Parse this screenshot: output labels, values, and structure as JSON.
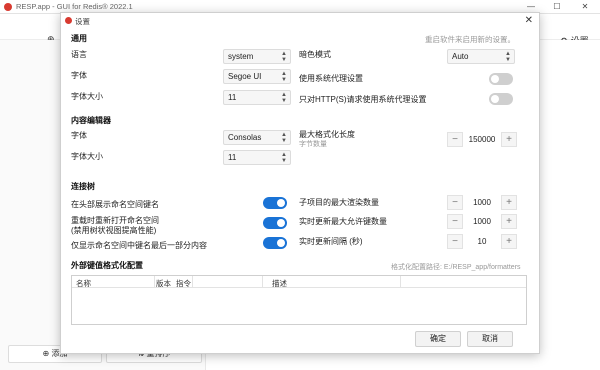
{
  "app": {
    "title": "RESP.app - GUI for Redis® 2022.1",
    "settings_label": "设置",
    "add_connection_label": "添加",
    "sort_label": "重排序",
    "minimize": "—",
    "maximize": "☐",
    "close": "✕",
    "plus_icon": "⊕"
  },
  "dialog": {
    "title": "设置",
    "close": "✕",
    "restart_hint": "重启软件来启用新的设置。",
    "general": {
      "title": "通用",
      "language_label": "语言",
      "language_value": "system",
      "font_label": "字体",
      "font_value": "Segoe UI",
      "font_size_label": "字体大小",
      "font_size_value": "11",
      "color_mode_label": "暗色模式",
      "color_mode_value": "Auto",
      "use_system_proxy_label": "使用系统代理设置",
      "use_system_proxy": false,
      "http_proxy_only_label": "只对HTTP(S)请求使用系统代理设置",
      "http_proxy_only": false
    },
    "editor": {
      "title": "内容编辑器",
      "font_label": "字体",
      "font_value": "Consolas",
      "font_size_label": "字体大小",
      "font_size_value": "11",
      "max_format_label": "最大格式化长度",
      "max_format_sublabel": "字节数量",
      "max_format_value": "150000"
    },
    "connections": {
      "title": "连接树",
      "show_ns_label": "在头部展示命名空间键名",
      "show_ns": true,
      "reopen_ns_label": "重载时重新打开命名空间",
      "reopen_ns_sublabel": "(禁用树状视图提高性能)",
      "reopen_ns": true,
      "last_part_label": "仅显示命名空间中键名最后一部分内容",
      "last_part": true,
      "live_limit_label": "子项目的最大渲染数量",
      "live_limit_value": "1000",
      "live_update_keys_label": "实时更新最大允许键数量",
      "live_update_keys_value": "1000",
      "live_update_interval_label": "实时更新间隔 (秒)",
      "live_update_interval_value": "10"
    },
    "formatters": {
      "title": "外部键值格式化配置",
      "path_label": "格式化配置路径: E:/RESP_app/formatters",
      "columns": [
        "名称",
        "版本",
        "指令",
        "描述"
      ]
    },
    "ok_label": "确定",
    "cancel_label": "取消"
  }
}
